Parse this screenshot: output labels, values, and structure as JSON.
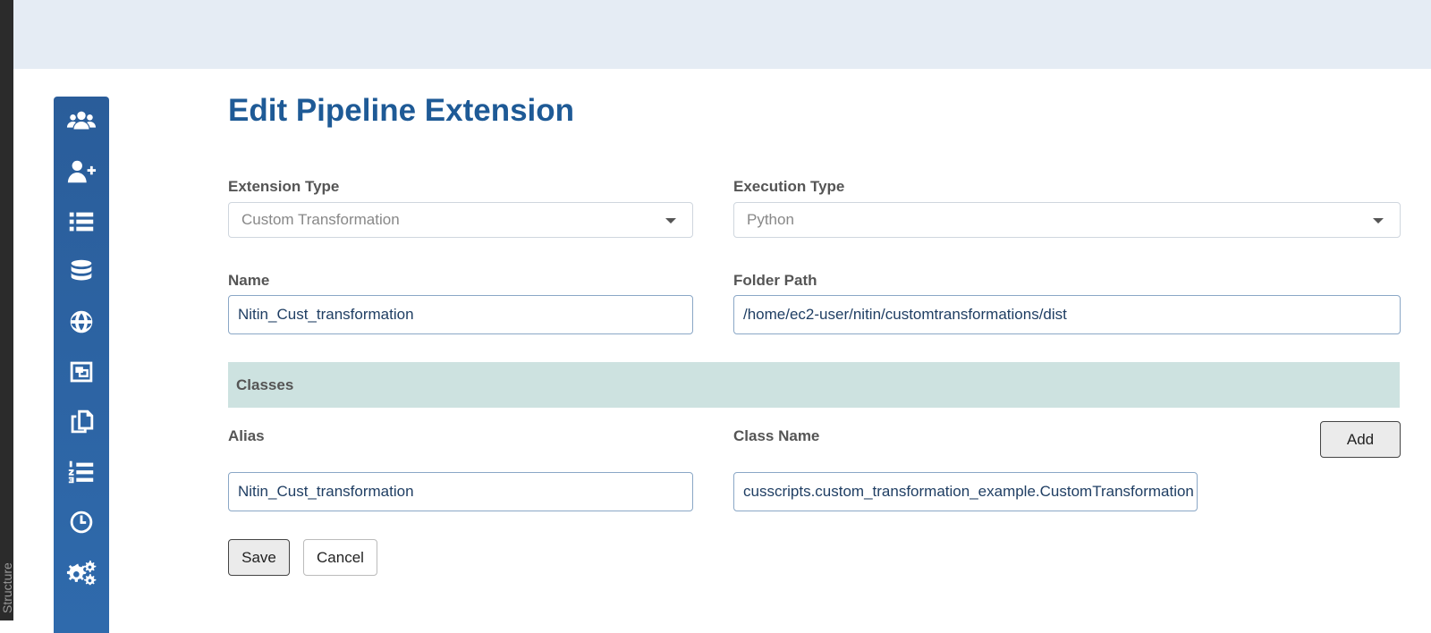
{
  "left_panel": {
    "label": "Structure"
  },
  "sidebar": {
    "items": [
      {
        "icon": "users-icon"
      },
      {
        "icon": "user-plus-icon"
      },
      {
        "icon": "list-icon"
      },
      {
        "icon": "database-icon"
      },
      {
        "icon": "globe-icon"
      },
      {
        "icon": "object-group-icon"
      },
      {
        "icon": "copy-icon"
      },
      {
        "icon": "numbered-list-icon"
      },
      {
        "icon": "clock-icon"
      },
      {
        "icon": "cogs-icon"
      }
    ],
    "color": "#2a5d9a"
  },
  "page": {
    "title": "Edit Pipeline Extension"
  },
  "form": {
    "extension_type": {
      "label": "Extension Type",
      "value": "Custom Transformation"
    },
    "execution_type": {
      "label": "Execution Type",
      "value": "Python"
    },
    "name": {
      "label": "Name",
      "value": "Nitin_Cust_transformation"
    },
    "folder_path": {
      "label": "Folder Path",
      "value": "/home/ec2-user/nitin/customtransformations/dist"
    }
  },
  "classes": {
    "header": "Classes",
    "alias_label": "Alias",
    "class_name_label": "Class Name",
    "add_label": "Add",
    "rows": [
      {
        "alias": "Nitin_Cust_transformation",
        "class_name": "cusscripts.custom_transformation_example.CustomTransformation"
      }
    ]
  },
  "actions": {
    "save_label": "Save",
    "cancel_label": "Cancel"
  },
  "colors": {
    "title": "#1e5a96",
    "top_bar": "#e5ecf4",
    "classes_bar": "#cde2e0"
  }
}
